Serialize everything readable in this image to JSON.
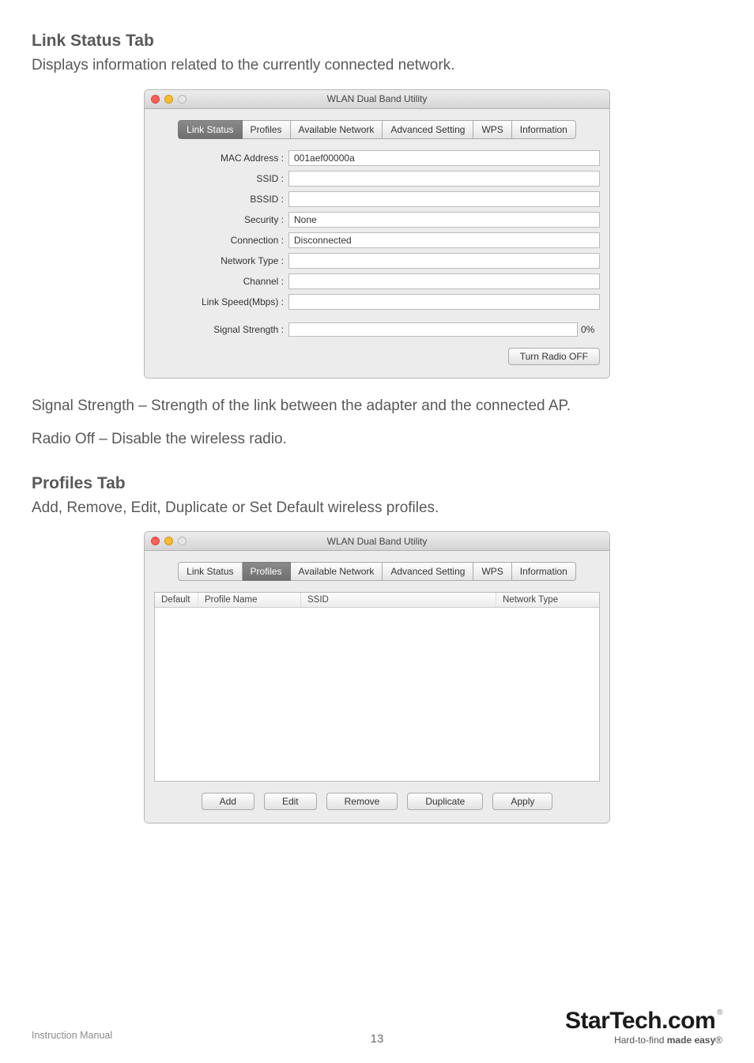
{
  "sections": {
    "link_status_heading": "Link Status Tab",
    "link_status_desc": "Displays information related to the currently connected network.",
    "profiles_heading": "Profiles Tab",
    "profiles_desc": "Add, Remove, Edit, Duplicate or Set Default wireless profiles."
  },
  "paragraphs": {
    "signal_strength": "Signal Strength – Strength of the link between the adapter and the connected AP.",
    "radio_off": "Radio Off – Disable the wireless radio."
  },
  "window": {
    "title": "WLAN Dual Band Utility"
  },
  "tabs": {
    "link_status": "Link Status",
    "profiles": "Profiles",
    "available_network": "Available Network",
    "advanced_setting": "Advanced Setting",
    "wps": "WPS",
    "information": "Information"
  },
  "status_form": {
    "labels": {
      "mac": "MAC Address :",
      "ssid": "SSID :",
      "bssid": "BSSID :",
      "security": "Security :",
      "connection": "Connection :",
      "network_type": "Network Type :",
      "channel": "Channel :",
      "link_speed": "Link Speed(Mbps) :",
      "signal_strength": "Signal Strength :"
    },
    "values": {
      "mac": "001aef00000a",
      "ssid": "",
      "bssid": "",
      "security": "None",
      "connection": "Disconnected",
      "network_type": "",
      "channel": "",
      "link_speed": ""
    },
    "signal_pct": "0%",
    "turn_radio_btn": "Turn Radio OFF"
  },
  "profiles_table": {
    "headers": {
      "default": "Default",
      "profile_name": "Profile Name",
      "ssid": "SSID",
      "network_type": "Network Type"
    },
    "buttons": {
      "add": "Add",
      "edit": "Edit",
      "remove": "Remove",
      "duplicate": "Duplicate",
      "apply": "Apply"
    }
  },
  "footer": {
    "manual": "Instruction Manual",
    "page": "13",
    "brand": "StarTech.com",
    "tagline_plain": "Hard-to-find ",
    "tagline_bold": "made easy",
    "reg": "®"
  }
}
